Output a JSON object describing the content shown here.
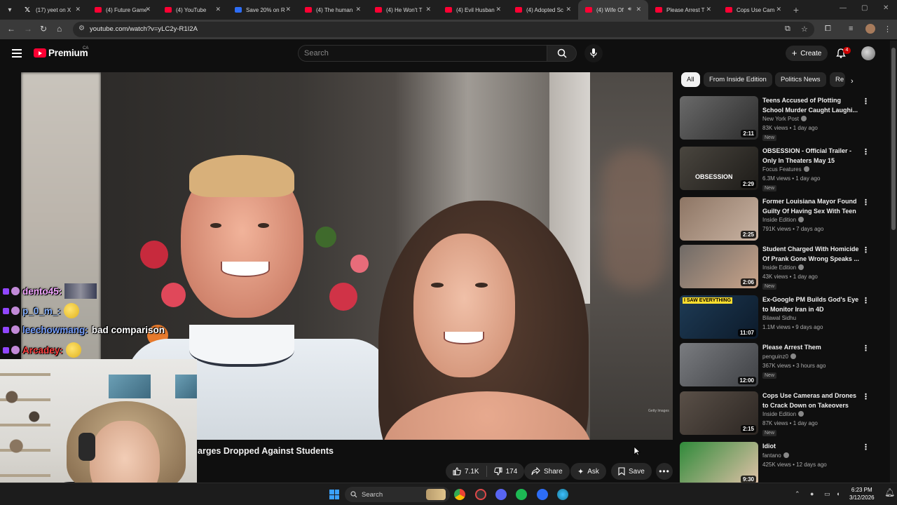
{
  "browser": {
    "tabs": [
      {
        "label": "(17) yeet on X",
        "icon": "x-logo-icon"
      },
      {
        "label": "(4) Future Game",
        "icon": "youtube-icon"
      },
      {
        "label": "(4) YouTube",
        "icon": "youtube-icon"
      },
      {
        "label": "Save 20% on R",
        "icon": "steam-icon"
      },
      {
        "label": "(4) The human",
        "icon": "youtube-icon"
      },
      {
        "label": "(4) He Won't T",
        "icon": "youtube-icon"
      },
      {
        "label": "(4) Evil Husban",
        "icon": "youtube-icon"
      },
      {
        "label": "(4) Adopted Sc",
        "icon": "youtube-icon"
      },
      {
        "label": "(4) Wife Of",
        "icon": "youtube-icon",
        "active": true
      },
      {
        "label": "Please Arrest T",
        "icon": "youtube-icon"
      },
      {
        "label": "Cops Use Cam",
        "icon": "youtube-icon"
      }
    ],
    "url": "youtube.com/watch?v=yLC2y-R1I2A"
  },
  "yt_header": {
    "logo_text": "Premium",
    "region": "CA",
    "search_placeholder": "Search",
    "create_label": "Create",
    "notifications_count": "4"
  },
  "video": {
    "title_visible": "arges Dropped Against Students",
    "likes": "7.1K",
    "dislikes": "174",
    "share_label": "Share",
    "ask_label": "Ask",
    "save_label": "Save",
    "watermark": "Getty Images"
  },
  "chat_overlay": [
    {
      "user": "dento45:",
      "message": "",
      "user_color": "#f3a6ff"
    },
    {
      "user": "p_0_m_:",
      "message": "",
      "user_color": "#8ab4ff"
    },
    {
      "user": "leechowmang:",
      "message": "bad comparison",
      "user_color": "#7aa2ff"
    },
    {
      "user": "Arcadey:",
      "message": "",
      "user_color": "#ff4040"
    }
  ],
  "chips": [
    "All",
    "From Inside Edition",
    "Politics News",
    "Re"
  ],
  "recommendations": [
    {
      "title": "Teens Accused of Plotting School Murder Caught Laughi...",
      "channel": "New York Post",
      "meta": "83K views • 1 day ago",
      "badge": "New",
      "duration": "2:11",
      "thumb_colors": [
        "#6a6a6a",
        "#2c2c2c"
      ]
    },
    {
      "title": "OBSESSION - Official Trailer - Only In Theaters May 15",
      "channel": "Focus Features",
      "meta": "6.3M views • 1 day ago",
      "badge": "New",
      "duration": "2:29",
      "thumb_text": "OBSESSION",
      "thumb_colors": [
        "#4a463f",
        "#1d1b18"
      ]
    },
    {
      "title": "Former Louisiana Mayor Found Guilty Of Having Sex With Teen",
      "channel": "Inside Edition",
      "meta": "791K views • 7 days ago",
      "badge": "",
      "duration": "2:25",
      "thumb_colors": [
        "#8d7564",
        "#c9b3a2"
      ]
    },
    {
      "title": "Student Charged With Homicide Of Prank Gone Wrong Speaks ...",
      "channel": "Inside Edition",
      "meta": "43K views • 1 day ago",
      "badge": "New",
      "duration": "2:06",
      "thumb_colors": [
        "#6f6a66",
        "#c9a48a"
      ]
    },
    {
      "title": "Ex-Google PM Builds God's Eye to Monitor Iran in 4D",
      "channel": "Bilawal Sidhu",
      "meta": "1.1M views • 9 days ago",
      "badge": "",
      "duration": "11:07",
      "thumb_text": "I SAW EVERYTHING",
      "thumb_colors": [
        "#1e3b55",
        "#0c1a2a"
      ]
    },
    {
      "title": "Please Arrest Them",
      "channel": "penguinz0",
      "meta": "367K views • 3 hours ago",
      "badge": "New",
      "duration": "12:00",
      "thumb_colors": [
        "#7a7c80",
        "#3e4044"
      ]
    },
    {
      "title": "Cops Use Cameras and Drones to Crack Down on Takeovers",
      "channel": "Inside Edition",
      "meta": "87K views • 1 day ago",
      "badge": "New",
      "duration": "2:15",
      "thumb_colors": [
        "#5a5048",
        "#2c2622"
      ]
    },
    {
      "title": "Idiot",
      "channel": "fantano",
      "meta": "425K views • 12 days ago",
      "badge": "",
      "duration": "9:30",
      "thumb_colors": [
        "#2f8a3a",
        "#e2c2a8"
      ]
    }
  ],
  "taskbar": {
    "search_label": "Search",
    "time": "6:23 PM",
    "date": "3/12/2026"
  }
}
